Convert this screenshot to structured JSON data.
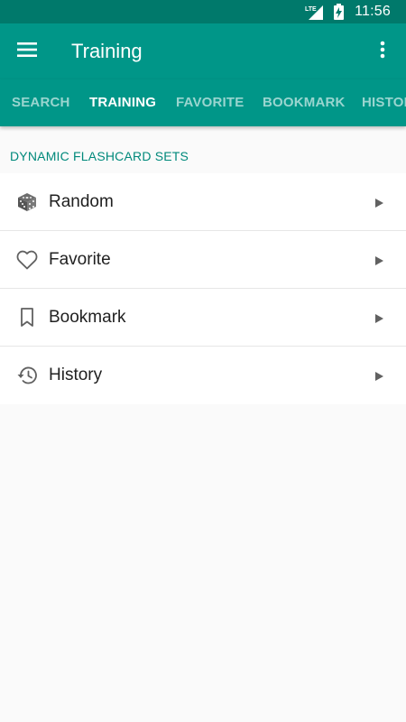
{
  "status_bar": {
    "network_label": "LTE",
    "time": "11:56"
  },
  "app_bar": {
    "title": "Training",
    "menu_icon": "hamburger-menu-icon",
    "more_icon": "more-vert-icon"
  },
  "tabs": [
    {
      "label": "SEARCH",
      "active": false
    },
    {
      "label": "TRAINING",
      "active": true
    },
    {
      "label": "FAVORITE",
      "active": false
    },
    {
      "label": "BOOKMARK",
      "active": false
    },
    {
      "label": "HISTORY",
      "active": false
    }
  ],
  "section": {
    "header": "DYNAMIC FLASHCARD SETS"
  },
  "items": [
    {
      "label": "Random",
      "icon": "dice-icon"
    },
    {
      "label": "Favorite",
      "icon": "heart-icon"
    },
    {
      "label": "Bookmark",
      "icon": "bookmark-icon"
    },
    {
      "label": "History",
      "icon": "history-icon"
    }
  ],
  "colors": {
    "status_bar": "#00796b",
    "primary": "#009688",
    "accent_text": "#00897b"
  }
}
